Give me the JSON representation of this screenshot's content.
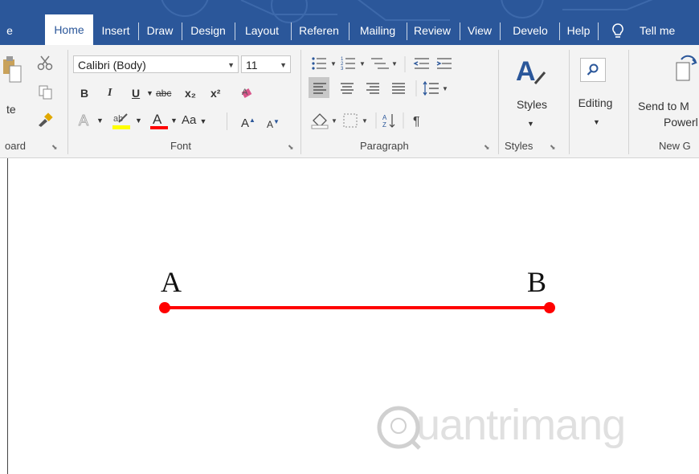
{
  "tabs": [
    {
      "label": "e",
      "active": false
    },
    {
      "label": "Home",
      "active": true
    },
    {
      "label": "Insert",
      "active": false
    },
    {
      "label": "Draw",
      "active": false
    },
    {
      "label": "Design",
      "active": false
    },
    {
      "label": "Layout",
      "active": false
    },
    {
      "label": "Referen",
      "active": false
    },
    {
      "label": "Mailing",
      "active": false
    },
    {
      "label": "Review",
      "active": false
    },
    {
      "label": "View",
      "active": false
    },
    {
      "label": "Develo",
      "active": false
    },
    {
      "label": "Help",
      "active": false
    }
  ],
  "tell_me": "Tell me",
  "clipboard": {
    "paste_label": "te",
    "group_label": "oard"
  },
  "font": {
    "name": "Calibri (Body)",
    "size": "11",
    "bold": "B",
    "italic": "I",
    "underline": "U",
    "strike": "abc",
    "subscript": "x₂",
    "superscript": "x²",
    "change_case": "Aa",
    "grow": "A",
    "shrink": "A",
    "group_label": "Font"
  },
  "paragraph": {
    "group_label": "Paragraph"
  },
  "styles": {
    "button_label": "Styles",
    "group_label": "Styles"
  },
  "editing": {
    "button_label": "Editing"
  },
  "newgroup": {
    "button_line1": "Send to M",
    "button_line2": "Powerl",
    "group_label": "New G"
  },
  "document": {
    "point_a": "A",
    "point_b": "B",
    "segment_color": "#ff0000",
    "watermark": "uantrimang"
  },
  "colors": {
    "brand": "#2b579a",
    "highlight": "#ffff00",
    "font_color": "#ff0000"
  }
}
